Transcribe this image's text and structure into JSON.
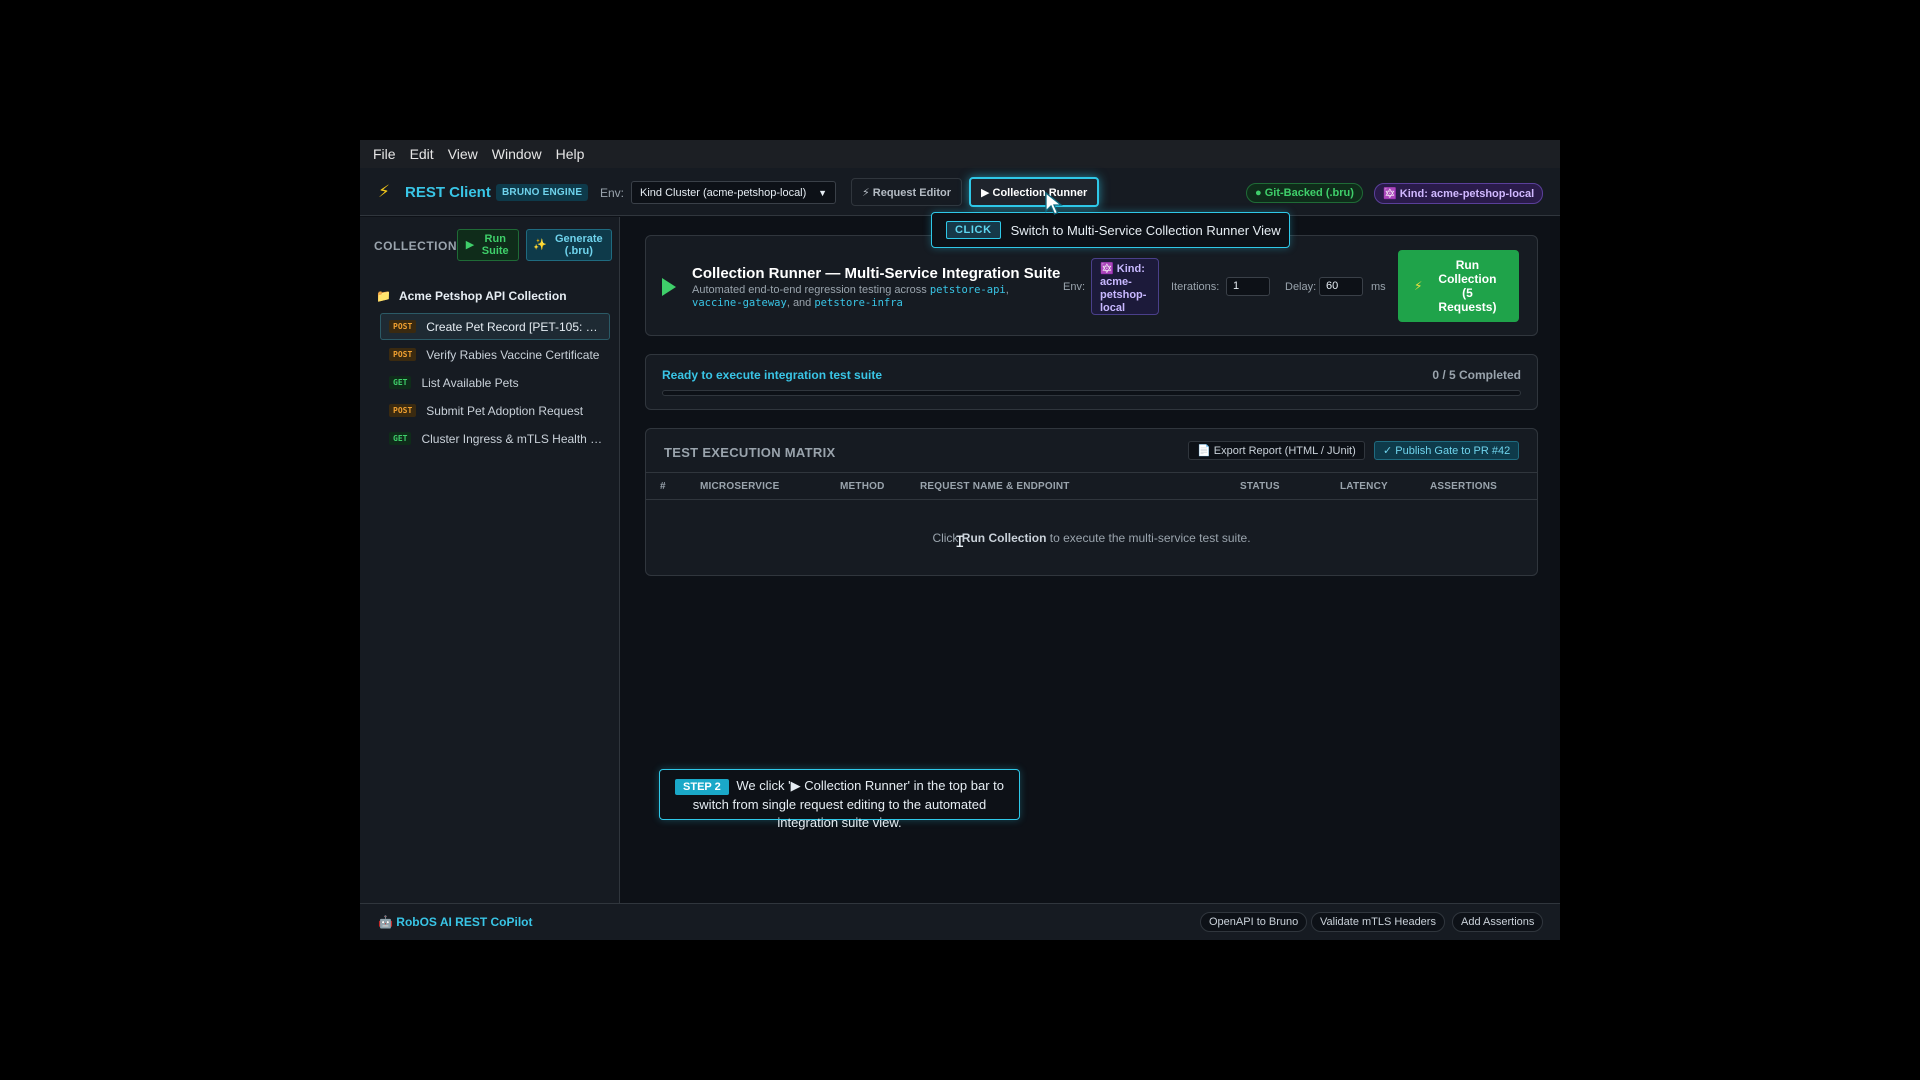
{
  "menubar": [
    "File",
    "Edit",
    "View",
    "Window",
    "Help"
  ],
  "topbar": {
    "brand_icon": "⚡",
    "brand_name": "REST Client",
    "engine_badge": "BRUNO ENGINE",
    "env_label": "Env:",
    "env_value": "Kind Cluster (acme-petshop-local)",
    "tab_request_editor": "⚡ Request Editor",
    "tab_collection_runner": "▶ Collection Runner",
    "git_badge": "● Git-Backed (.bru)",
    "kind_badge": "🔯 Kind: acme-petshop-local"
  },
  "tooltip": {
    "badge": "CLICK",
    "text": "Switch to Multi-Service Collection Runner View"
  },
  "sidebar": {
    "header": "COLLECTIONS",
    "run_suite_label": "Run Suite",
    "generate_label": "Generate (.bru)",
    "collection_name": "Acme Petshop API Collection",
    "requests": [
      {
        "method": "POST",
        "name": "Create Pet Record [PET-105: …",
        "active": true
      },
      {
        "method": "POST",
        "name": "Verify Rabies Vaccine Certificate",
        "active": false
      },
      {
        "method": "GET",
        "name": "List Available Pets",
        "active": false
      },
      {
        "method": "POST",
        "name": "Submit Pet Adoption Request",
        "active": false
      },
      {
        "method": "GET",
        "name": "Cluster Ingress & mTLS Health …",
        "active": false
      }
    ]
  },
  "runner": {
    "title": "Collection Runner — Multi-Service Integration Suite",
    "desc_prefix": "Automated end-to-end regression testing across ",
    "service_1": "petstore-api",
    "service_2": "vaccine-gateway",
    "desc_and": ", and ",
    "service_3": "petstore-infra",
    "env_label": "Env:",
    "env_badge": "🔯 Kind: acme-petshop-local",
    "iterations_label": "Iterations:",
    "iterations_value": "1",
    "delay_label": "Delay:",
    "delay_value": "60",
    "delay_unit": "ms",
    "run_button": "Run Collection (5 Requests)"
  },
  "status": {
    "text": "Ready to execute integration test suite",
    "count": "0 / 5 Completed",
    "progress": 0
  },
  "matrix": {
    "title": "TEST EXECUTION MATRIX",
    "export_label": "📄 Export Report (HTML / JUnit)",
    "publish_label": "✓ Publish Gate to PR #42",
    "columns": [
      "#",
      "MICROSERVICE",
      "METHOD",
      "REQUEST NAME & ENDPOINT",
      "STATUS",
      "LATENCY",
      "ASSERTIONS"
    ],
    "empty_prefix": "Click ",
    "empty_bold": "Run Collection",
    "empty_suffix": " to execute the multi-service test suite."
  },
  "step": {
    "badge": "STEP 2",
    "text": "We click '▶ Collection Runner' in the top bar to switch from single request editing to the automated integration suite view."
  },
  "footer": {
    "copilot": "🤖 RobOS AI REST CoPilot",
    "chips": [
      "OpenAPI to Bruno",
      "Validate mTLS Headers",
      "Add Assertions"
    ]
  },
  "colors": {
    "accent": "#2fc8e8",
    "success": "#1fa34a",
    "background": "#0d1117"
  }
}
